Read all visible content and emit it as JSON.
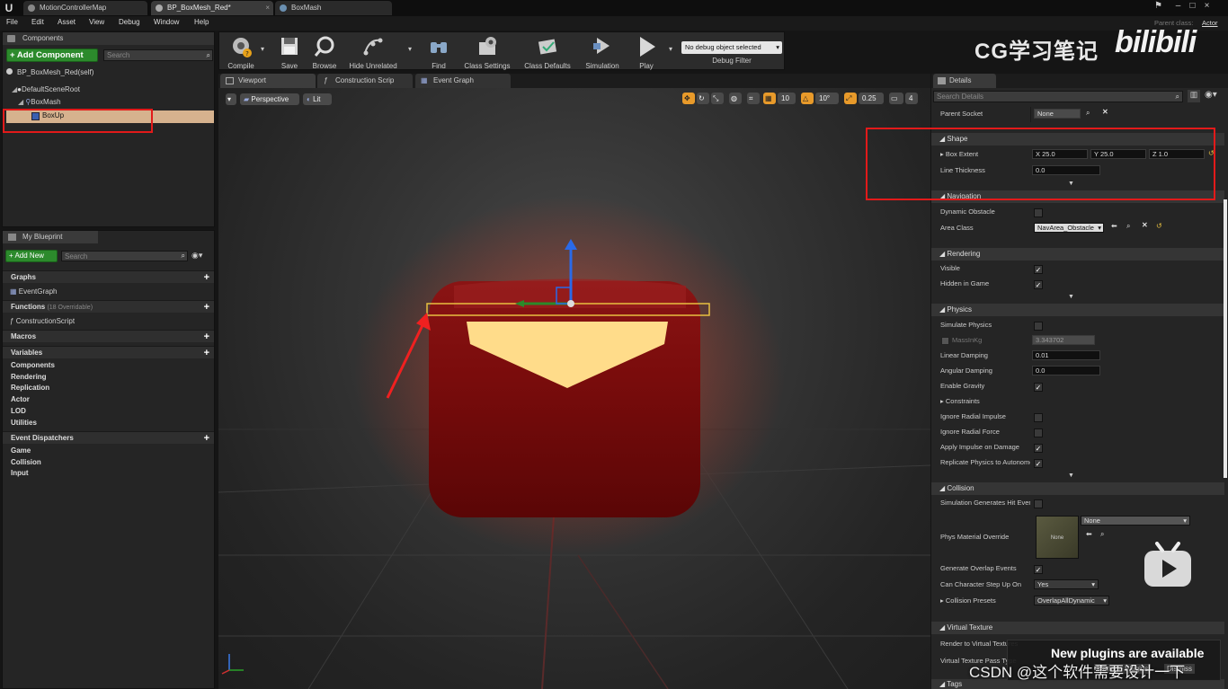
{
  "tabs": [
    {
      "label": "MotionControllerMap",
      "active": false
    },
    {
      "label": "BP_BoxMesh_Red*",
      "active": true
    },
    {
      "label": "BoxMash",
      "active": false
    }
  ],
  "parent_class": {
    "label": "Parent class:",
    "value": "Actor"
  },
  "menu": [
    "File",
    "Edit",
    "Asset",
    "View",
    "Debug",
    "Window",
    "Help"
  ],
  "components": {
    "title": "Components",
    "add_button": "+ Add Component",
    "search_placeholder": "Search",
    "self_item": "BP_BoxMesh_Red(self)",
    "tree": [
      "DefaultSceneRoot",
      "BoxMash",
      "BoxUp"
    ]
  },
  "my_blueprint": {
    "title": "My Blueprint",
    "add_new": "+ Add New",
    "search_placeholder": "Search",
    "graphs": "Graphs",
    "event_graph": "EventGraph",
    "functions": "Functions",
    "functions_note": "(18 Overridable)",
    "construction_script": "ConstructionScript",
    "macros": "Macros",
    "variables": "Variables",
    "variable_categories": [
      "Components",
      "Rendering",
      "Replication",
      "Actor",
      "LOD",
      "Utilities"
    ],
    "event_dispatchers": "Event Dispatchers",
    "dispatcher_categories": [
      "Game",
      "Collision",
      "Input"
    ]
  },
  "toolbar": {
    "buttons": [
      "Compile",
      "Save",
      "Browse",
      "Hide Unrelated",
      "Find",
      "Class Settings",
      "Class Defaults",
      "Simulation",
      "Play"
    ],
    "debug_select": "No debug object selected",
    "debug_filter": "Debug Filter"
  },
  "editor_tabs": [
    "Viewport",
    "Construction Scrip",
    "Event Graph"
  ],
  "viewport": {
    "perspective": "Perspective",
    "lit": "Lit",
    "grid_snap": "10",
    "rot_snap": "10°",
    "scale_snap": "0.25",
    "cam_speed": "4"
  },
  "details": {
    "title": "Details",
    "search_placeholder": "Search Details",
    "parent_socket": {
      "label": "Parent Socket",
      "value": "None"
    },
    "shape": {
      "title": "Shape",
      "box_extent_label": "Box Extent",
      "x": "X  25.0",
      "y": "Y  25.0",
      "z": "Z  1.0",
      "line_thickness_label": "Line Thickness",
      "line_thickness": "0.0"
    },
    "navigation": {
      "title": "Navigation",
      "dynamic_obstacle": "Dynamic Obstacle",
      "dynamic_obstacle_checked": false,
      "area_class": "Area Class",
      "area_class_value": "NavArea_Obstacle"
    },
    "rendering": {
      "title": "Rendering",
      "visible": "Visible",
      "visible_checked": true,
      "hidden_in_game": "Hidden in Game",
      "hidden_in_game_checked": true
    },
    "physics": {
      "title": "Physics",
      "simulate_physics": "Simulate Physics",
      "simulate_physics_checked": false,
      "mass_label": "MassInKg",
      "mass_value": "3.343702",
      "linear_damping": "Linear Damping",
      "linear_damping_value": "0.01",
      "angular_damping": "Angular Damping",
      "angular_damping_value": "0.0",
      "enable_gravity": "Enable Gravity",
      "enable_gravity_checked": true,
      "constraints": "Constraints",
      "ignore_radial_impulse": "Ignore Radial Impulse",
      "ignore_radial_impulse_checked": false,
      "ignore_radial_force": "Ignore Radial Force",
      "ignore_radial_force_checked": false,
      "apply_impulse": "Apply Impulse on Damage",
      "apply_impulse_checked": true,
      "replicate_physics": "Replicate Physics to Autonomous Proxy",
      "replicate_physics_checked": true
    },
    "collision": {
      "title": "Collision",
      "sim_hit_events": "Simulation Generates Hit Events",
      "sim_hit_events_checked": false,
      "phys_material": "Phys Material Override",
      "phys_material_thumb": "None",
      "phys_material_value": "None",
      "overlap_events": "Generate Overlap Events",
      "overlap_events_checked": true,
      "step_up": "Can Character Step Up On",
      "step_up_value": "Yes",
      "presets": "Collision Presets",
      "presets_value": "OverlapAllDynamic"
    },
    "virtual_texture": {
      "title": "Virtual Texture",
      "render_label": "Render to Virtual Textures",
      "pass_label": "Virtual Texture Pass Type"
    },
    "tags": "Tags"
  },
  "watermarks": {
    "top": "CG学习笔记",
    "brand": "bilibili",
    "bottom": "CSDN @这个软件需要设计一下"
  },
  "notification": {
    "title": "New plugins are available",
    "action": "Manage Plugins",
    "dismiss": "Dismiss"
  },
  "colors": {
    "accent_green": "#2c8a2c",
    "highlight_red": "#e21a1a",
    "selected_row": "#d6b28e"
  }
}
